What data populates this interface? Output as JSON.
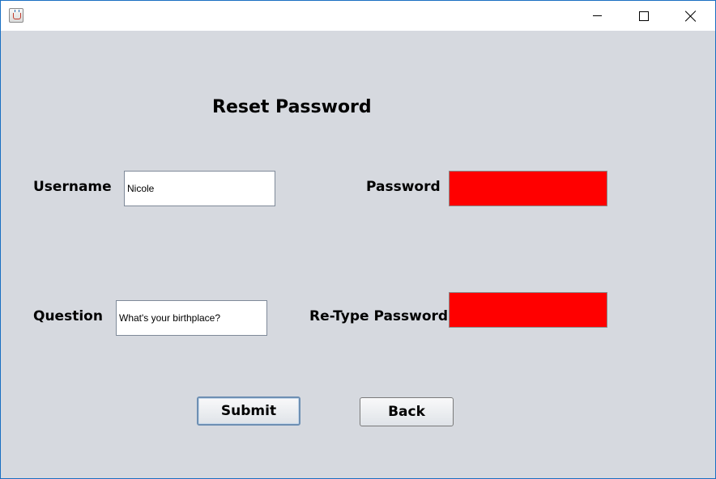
{
  "window": {
    "app_icon": "java-cup-icon",
    "controls": {
      "minimize_icon": "minimize-icon",
      "maximize_icon": "maximize-icon",
      "close_icon": "close-icon"
    }
  },
  "form": {
    "title": "Reset Password",
    "username": {
      "label": "Username",
      "value": "Nicole"
    },
    "password": {
      "label": "Password",
      "value": "",
      "state_color": "#ff0000"
    },
    "question": {
      "label": "Question",
      "value": "What's your birthplace?"
    },
    "retype_password": {
      "label": "Re-Type Password",
      "value": "",
      "state_color": "#ff0000"
    }
  },
  "buttons": {
    "submit": "Submit",
    "back": "Back"
  }
}
